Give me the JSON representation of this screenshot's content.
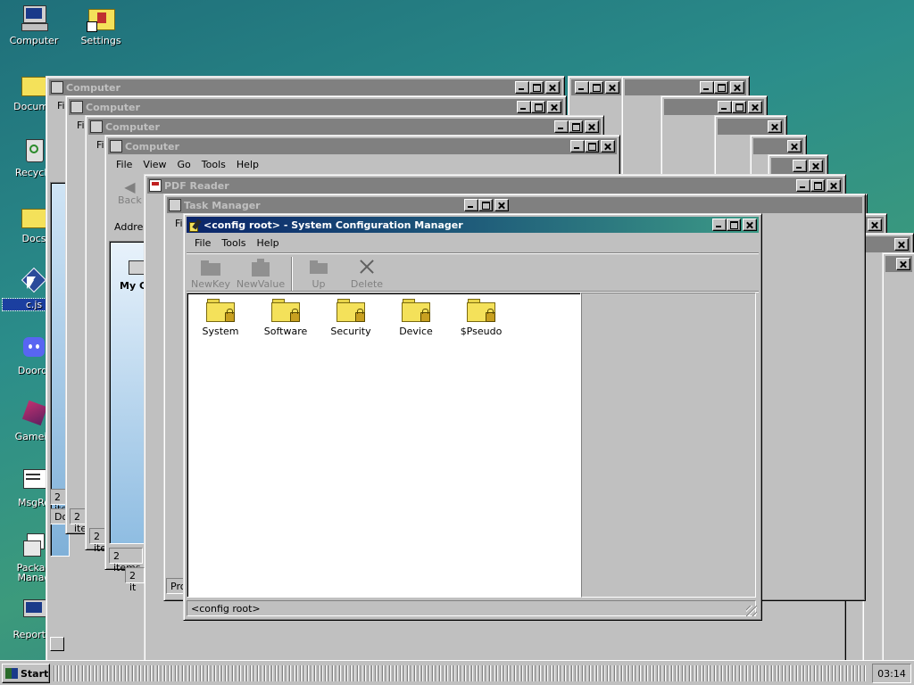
{
  "desktop": {
    "icons": [
      {
        "label": "Computer"
      },
      {
        "label": "Settings"
      },
      {
        "label": "Docume"
      },
      {
        "label": "Recycle"
      },
      {
        "label": "Docs"
      },
      {
        "label": "c.js"
      },
      {
        "label": "Doordi"
      },
      {
        "label": "Gamein"
      },
      {
        "label": "MsgRo"
      },
      {
        "label": "Packag Manag"
      },
      {
        "label": "Report E"
      }
    ]
  },
  "background_windows": [
    {
      "title": "Computer",
      "menu_fragment": "Fi",
      "status": "2 ite",
      "status2": "Do"
    },
    {
      "title": "Computer",
      "menu_fragment": "Fi",
      "status": "2 ite"
    },
    {
      "title": "Computer",
      "menu_fragment": "Fi",
      "status": "2 ite"
    },
    {
      "title": "Computer",
      "menu": [
        "File",
        "View",
        "Go",
        "Tools",
        "Help"
      ],
      "toolbar_fragment": "Back",
      "address_fragment": "Addres",
      "item_fragment": "My C",
      "status": "2 items"
    },
    {
      "title": "PDF Reader",
      "status": "2 it"
    },
    {
      "title": "Task Manager",
      "menu_fragment": "File",
      "status": "Pro"
    }
  ],
  "config_manager": {
    "title": "<config root> - System Configuration Manager",
    "menu": [
      "File",
      "Tools",
      "Help"
    ],
    "toolbar": [
      {
        "label": "NewKey",
        "icon": "folder-icon"
      },
      {
        "label": "NewValue",
        "icon": "value-icon"
      },
      {
        "label": "Up",
        "icon": "folder-up-icon"
      },
      {
        "label": "Delete",
        "icon": "delete-x-icon"
      }
    ],
    "folders": [
      {
        "label": "System"
      },
      {
        "label": "Software"
      },
      {
        "label": "Security"
      },
      {
        "label": "Device"
      },
      {
        "label": "$Pseudo"
      }
    ],
    "status": "<config root>"
  },
  "taskbar": {
    "start_label": "Start",
    "clock": "03:14"
  }
}
